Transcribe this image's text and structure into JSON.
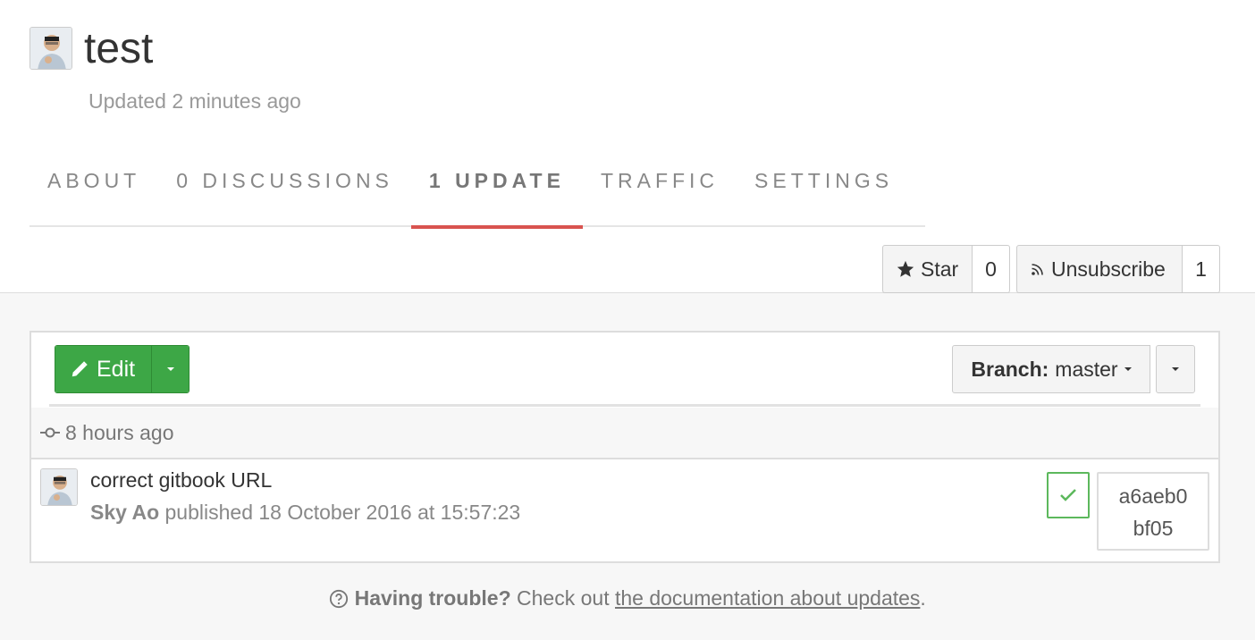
{
  "header": {
    "title": "test",
    "updated": "Updated 2 minutes ago"
  },
  "tabs": [
    {
      "label": "ABOUT"
    },
    {
      "label": "0 DISCUSSIONS"
    },
    {
      "label": "1 UPDATE",
      "active": true
    },
    {
      "label": "TRAFFIC"
    },
    {
      "label": "SETTINGS"
    }
  ],
  "actions": {
    "star_label": "Star",
    "star_count": "0",
    "unsubscribe_label": "Unsubscribe",
    "subscriber_count": "1"
  },
  "toolbar": {
    "edit_label": "Edit",
    "branch_prefix": "Branch:",
    "branch_value": "master"
  },
  "updates": {
    "date_label": "8 hours ago",
    "commit": {
      "message": "correct gitbook URL",
      "author": "Sky Ao",
      "published": "published 18 October 2016 at 15:57:23",
      "sha_line1": "a6aeb0",
      "sha_line2": "bf05"
    }
  },
  "footer": {
    "bold": "Having trouble?",
    "text": " Check out ",
    "link": "the documentation about updates",
    "end": "."
  },
  "colors": {
    "accent_tab": "#d9534f",
    "edit_green": "#3da746",
    "check_green": "#5cb85c"
  }
}
